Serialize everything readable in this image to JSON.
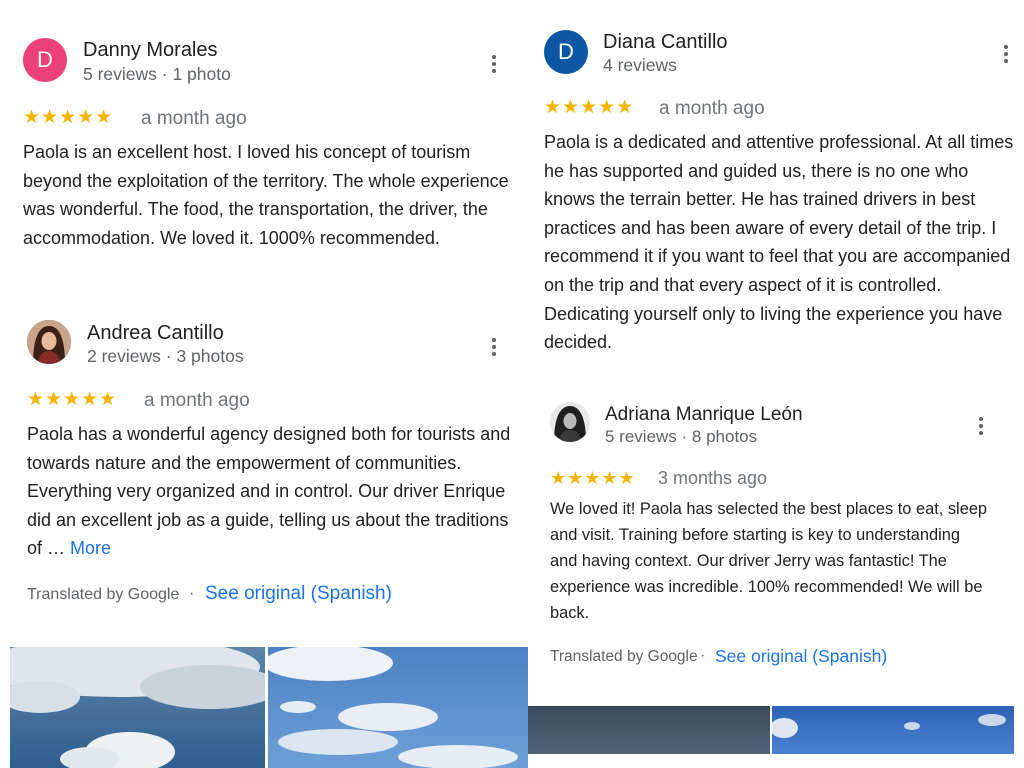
{
  "colors": {
    "accent": "#1a73e8",
    "star": "#f4b400",
    "avatar_pink": "#ec407a",
    "avatar_blue": "#0b57a4"
  },
  "reviews_left": [
    {
      "avatar_letter": "D",
      "name": "Danny Morales",
      "meta": "5 reviews · 1 photo",
      "stars": "★★★★★",
      "rating": 5,
      "date": "a month ago",
      "text": "Paola is an excellent host. I loved his concept of tourism beyond the exploitation of the territory. The whole experience was wonderful. The food, the transportation, the driver, the accommodation. We loved it. 1000% recommended."
    },
    {
      "avatar_icon": "profile-photo",
      "name": "Andrea Cantillo",
      "meta": "2 reviews · 3 photos",
      "stars": "★★★★★",
      "rating": 5,
      "date": "a month ago",
      "text": "Paola has a wonderful agency designed both for tourists and towards nature and the empowerment of communities. Everything very organized and in control. Our driver Enrique did an excellent job as a guide, telling us about the traditions of … ",
      "more_label": "More",
      "translated_label": "Translated by Google",
      "separator": "·",
      "see_original_label": "See original (Spanish)"
    }
  ],
  "reviews_right": [
    {
      "avatar_letter": "D",
      "name": "Diana Cantillo",
      "meta": "4 reviews",
      "stars": "★★★★★",
      "rating": 5,
      "date": "a month ago",
      "text": "Paola is a dedicated and attentive professional. At all times he has supported and guided us, there is no one who knows the terrain better. He has trained drivers in best practices and has been aware of every detail of the trip. I recommend it if you want to feel that you are accompanied on the trip and that every aspect of it is controlled. Dedicating yourself only to living the experience you have decided."
    },
    {
      "avatar_icon": "profile-photo",
      "name": "Adriana Manrique León",
      "meta": "5 reviews · 8 photos",
      "stars": "★★★★★",
      "rating": 5,
      "date": "3 months ago",
      "text": "We loved it! Paola has selected the best places to eat, sleep and visit. Training before starting is key to understanding and having context. Our driver Jerry was fantastic! The experience was incredible. 100% recommended! We will be back.",
      "translated_label": "Translated by Google",
      "separator": "·",
      "see_original_label": "See original (Spanish)"
    }
  ]
}
